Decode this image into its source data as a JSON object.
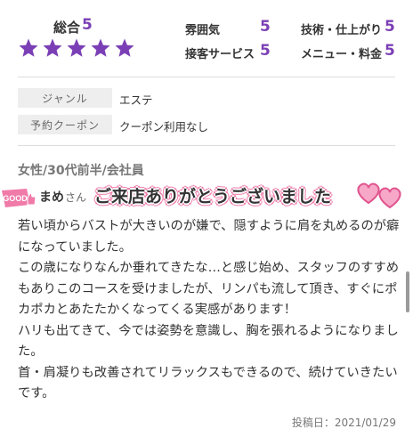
{
  "ratings": {
    "overall_label": "総合",
    "overall_score": "5",
    "star_count": 5,
    "star_color": "#7b3fb5",
    "items": [
      {
        "label": "雰囲気",
        "score": "5"
      },
      {
        "label": "技術・仕上がり",
        "score": "5"
      },
      {
        "label": "接客サービス",
        "score": "5"
      },
      {
        "label": "メニュー・料金",
        "score": "5"
      }
    ]
  },
  "info": {
    "genre_label": "ジャンル",
    "genre_value": "エステ",
    "coupon_label": "予約クーポン",
    "coupon_value": "クーポン利用なし"
  },
  "review": {
    "reviewer_meta": "女性/30代前半/会社員",
    "badge_text": "GOOD",
    "reviewer_name": "まめ",
    "reviewer_honorific": "さん",
    "title": "ご来店ありがとうございました",
    "body": [
      "若い頃からバストが大きいのが嫌で、隠すように肩を丸めるのが癖になっていました。",
      "この歳になりなんか垂れてきたな…と感じ始め、スタッフのすすめもありこのコースを受けましたが、リンパも流して頂き、すぐにポカポカとあたたかくなってくる実感があります！",
      "ハリも出てきて、今では姿勢を意識し、胸を張れるようになりました。",
      "首・肩凝りも改善されてリラックスもできるので、続けていきたいです。"
    ],
    "post_date": "投稿日：2021/01/29",
    "accent_color": "#f07aa8"
  }
}
